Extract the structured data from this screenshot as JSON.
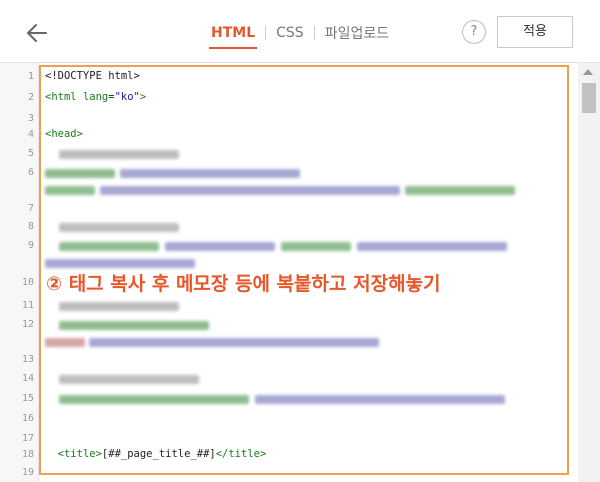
{
  "toolbar": {
    "back_icon": "arrow-left-icon",
    "tabs": [
      {
        "label": "HTML",
        "active": true
      },
      {
        "label": "CSS",
        "active": false
      },
      {
        "label": "파일업로드",
        "active": false
      }
    ],
    "help_label": "?",
    "apply_label": "적용"
  },
  "editor": {
    "line_numbers": [
      "1",
      "2",
      "3",
      "4",
      "5",
      "6",
      "7",
      "8",
      "9",
      "10",
      "11",
      "12",
      "13",
      "14",
      "15",
      "16",
      "17",
      "18",
      "19"
    ],
    "lines": {
      "l1": "<!DOCTYPE html>",
      "l2_open": "<html ",
      "l2_attr": "lang",
      "l2_eq": "=",
      "l2_val": "\"ko\"",
      "l2_close": ">",
      "l4": "<head>",
      "l18_indent": "  ",
      "l18_open": "<title>",
      "l18_text": "[##_page_title_##]",
      "l18_close": "</title>"
    }
  },
  "annotation": {
    "text": "② 태그 복사 후 메모장 등에 복붙하고 저장해놓기"
  },
  "colors": {
    "accent": "#e6572e",
    "highlight_border": "#f0a04b"
  }
}
